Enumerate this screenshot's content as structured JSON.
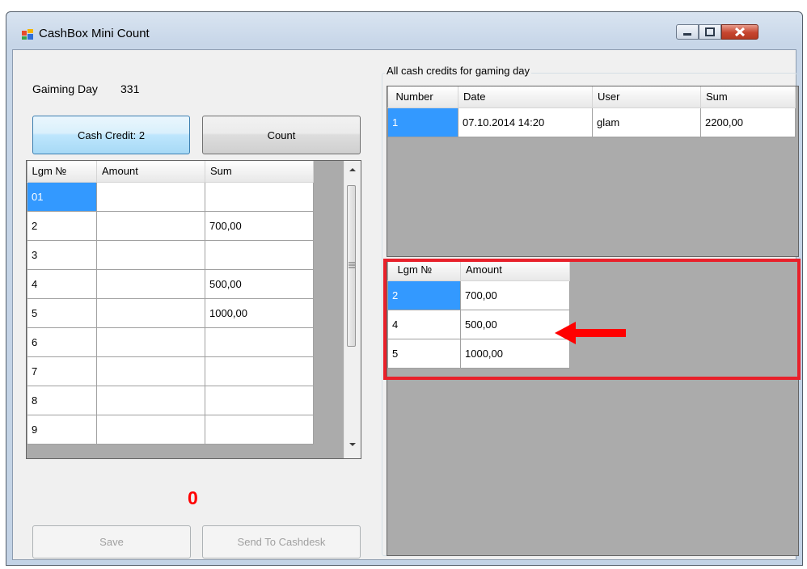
{
  "window": {
    "title": "CashBox Mini Count",
    "accent_color": "#c6452f"
  },
  "gaming_day": {
    "label": "Gaiming Day",
    "value": "331"
  },
  "buttons": {
    "cash_credit": "Cash Credit:  2",
    "count": "Count",
    "save": "Save",
    "send_to_cashdesk": "Send To Cashdesk"
  },
  "count_grid": {
    "headers": [
      "Lgm №",
      "Amount",
      "Sum"
    ],
    "rows": [
      {
        "lgm": "01",
        "amount": "",
        "sum": ""
      },
      {
        "lgm": "2",
        "amount": "",
        "sum": "700,00"
      },
      {
        "lgm": "3",
        "amount": "",
        "sum": ""
      },
      {
        "lgm": "4",
        "amount": "",
        "sum": "500,00"
      },
      {
        "lgm": "5",
        "amount": "",
        "sum": "1000,00"
      },
      {
        "lgm": "6",
        "amount": "",
        "sum": ""
      },
      {
        "lgm": "7",
        "amount": "",
        "sum": ""
      },
      {
        "lgm": "8",
        "amount": "",
        "sum": ""
      },
      {
        "lgm": "9",
        "amount": "",
        "sum": ""
      }
    ]
  },
  "total": {
    "value": "0",
    "color": "#ff0000"
  },
  "credits_group": {
    "title": "All cash credits for gaming day",
    "headers": [
      "Number",
      "Date",
      "User",
      "Sum"
    ],
    "rows": [
      {
        "number": "1",
        "date": "07.10.2014 14:20",
        "user": "glam",
        "sum": "2200,00"
      }
    ]
  },
  "credit_detail_grid": {
    "headers": [
      "Lgm №",
      "Amount"
    ],
    "rows": [
      {
        "lgm": "2",
        "amount": "700,00"
      },
      {
        "lgm": "4",
        "amount": "500,00"
      },
      {
        "lgm": "5",
        "amount": "1000,00"
      }
    ],
    "highlight_color": "#e8202a"
  }
}
